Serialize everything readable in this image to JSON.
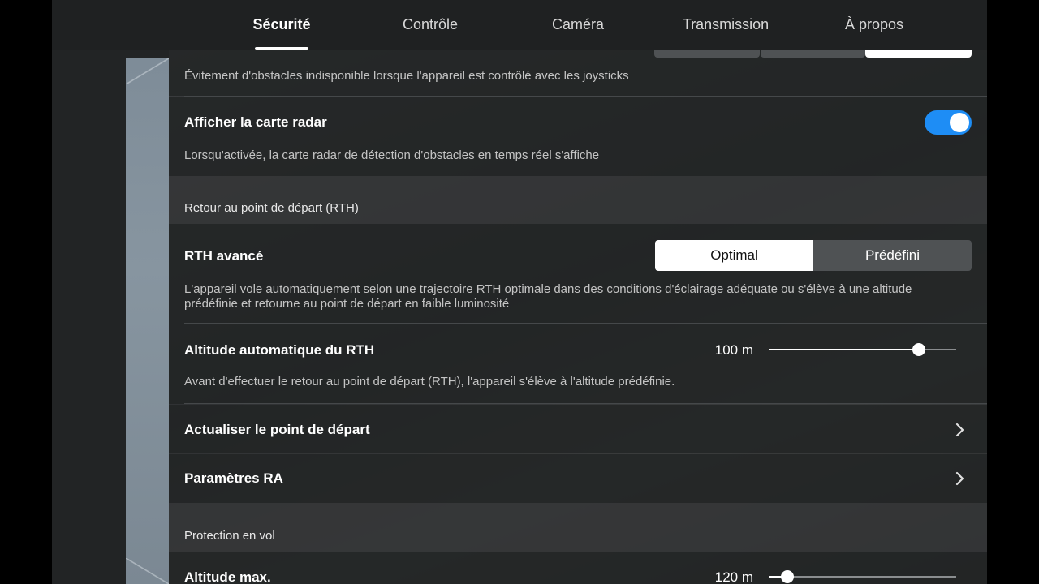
{
  "tabs": [
    {
      "label": "Sécurité",
      "active": true
    },
    {
      "label": "Contrôle",
      "active": false
    },
    {
      "label": "Caméra",
      "active": false
    },
    {
      "label": "Transmission",
      "active": false
    },
    {
      "label": "À propos",
      "active": false
    }
  ],
  "obstacle_note": "Évitement d'obstacles indisponible lorsque l'appareil est contrôlé avec les joysticks",
  "radar": {
    "title": "Afficher la carte radar",
    "desc": "Lorsqu'activée, la carte radar de détection d'obstacles en temps réel s'affiche",
    "enabled": true
  },
  "rth_section": "Retour au point de départ (RTH)",
  "rth_advanced": {
    "title": "RTH avancé",
    "options": [
      "Optimal",
      "Prédéfini"
    ],
    "selected": "Optimal",
    "desc_line1": "L'appareil vole automatiquement selon une trajectoire RTH optimale dans des conditions d'éclairage adéquate ou s'élève à une altitude",
    "desc_line2": "prédéfinie et retourne au point de départ en faible luminosité"
  },
  "rth_altitude": {
    "title": "Altitude automatique du RTH",
    "value": "100 m",
    "slider_fraction": 0.8,
    "desc": "Avant d'effectuer le retour au point de départ (RTH), l'appareil s'élève à l'altitude prédéfinie."
  },
  "update_home": {
    "title": "Actualiser le point de départ"
  },
  "ar_settings": {
    "title": "Paramètres RA"
  },
  "flight_protection_section": "Protection en vol",
  "max_altitude": {
    "title": "Altitude max.",
    "value": "120 m",
    "slider_fraction": 0.1
  },
  "colors": {
    "accent": "#1e8df5",
    "background": "#222425"
  }
}
